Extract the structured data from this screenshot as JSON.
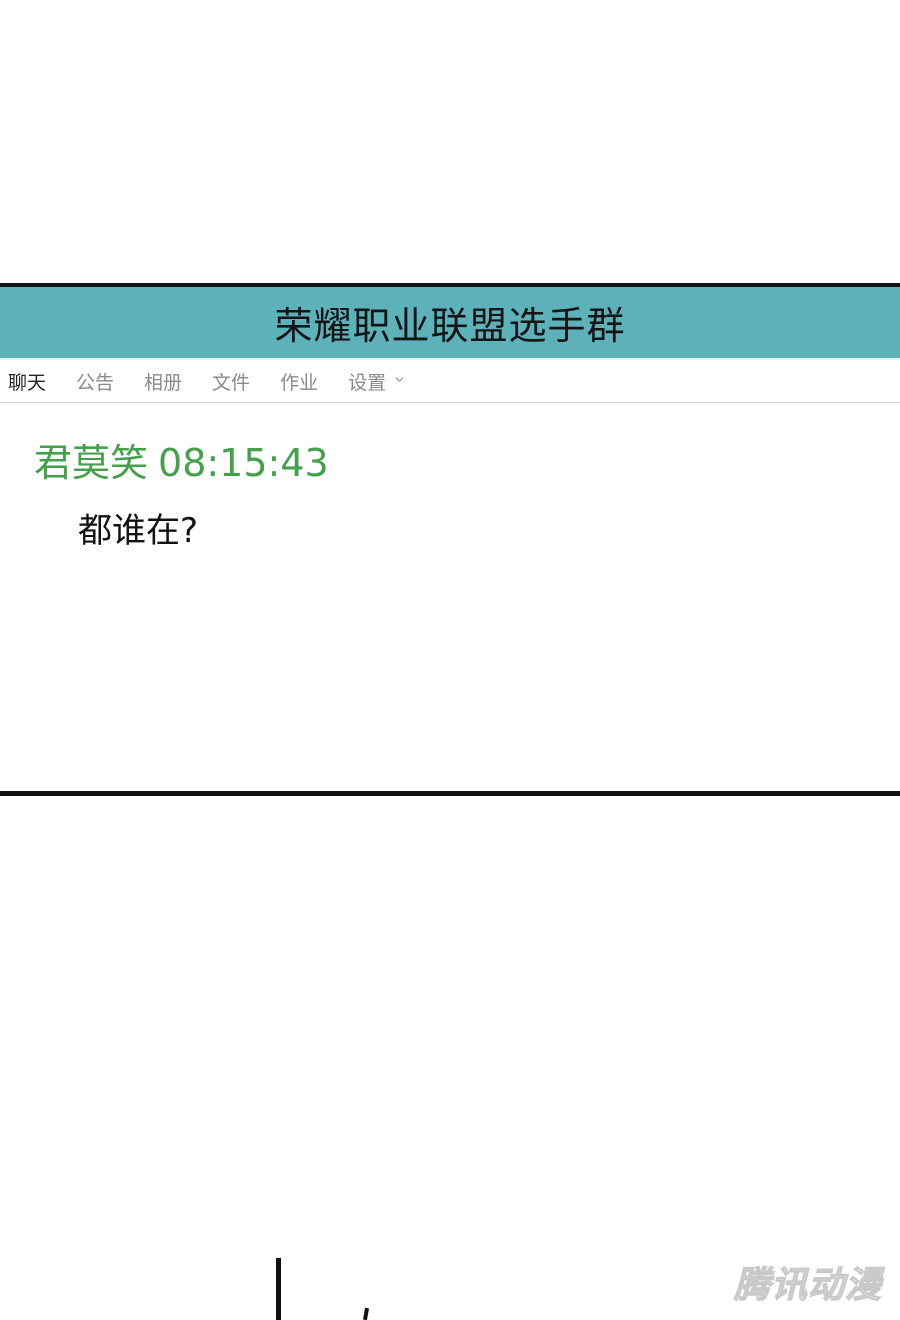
{
  "group": {
    "title": "荣耀职业联盟选手群"
  },
  "tabs": [
    {
      "label": "聊天",
      "active": true
    },
    {
      "label": "公告",
      "active": false
    },
    {
      "label": "相册",
      "active": false
    },
    {
      "label": "文件",
      "active": false
    },
    {
      "label": "作业",
      "active": false
    },
    {
      "label": "设置",
      "active": false
    }
  ],
  "icons": {
    "settings_dropdown": "chevron-down-icon"
  },
  "message": {
    "sender": "君莫笑",
    "time": "08:15:43",
    "text": "都谁在?"
  },
  "watermark": {
    "text": "腾讯动漫"
  },
  "colors": {
    "title_bar": "#5db1b8",
    "sender": "#43a149",
    "frame": "#111111"
  }
}
